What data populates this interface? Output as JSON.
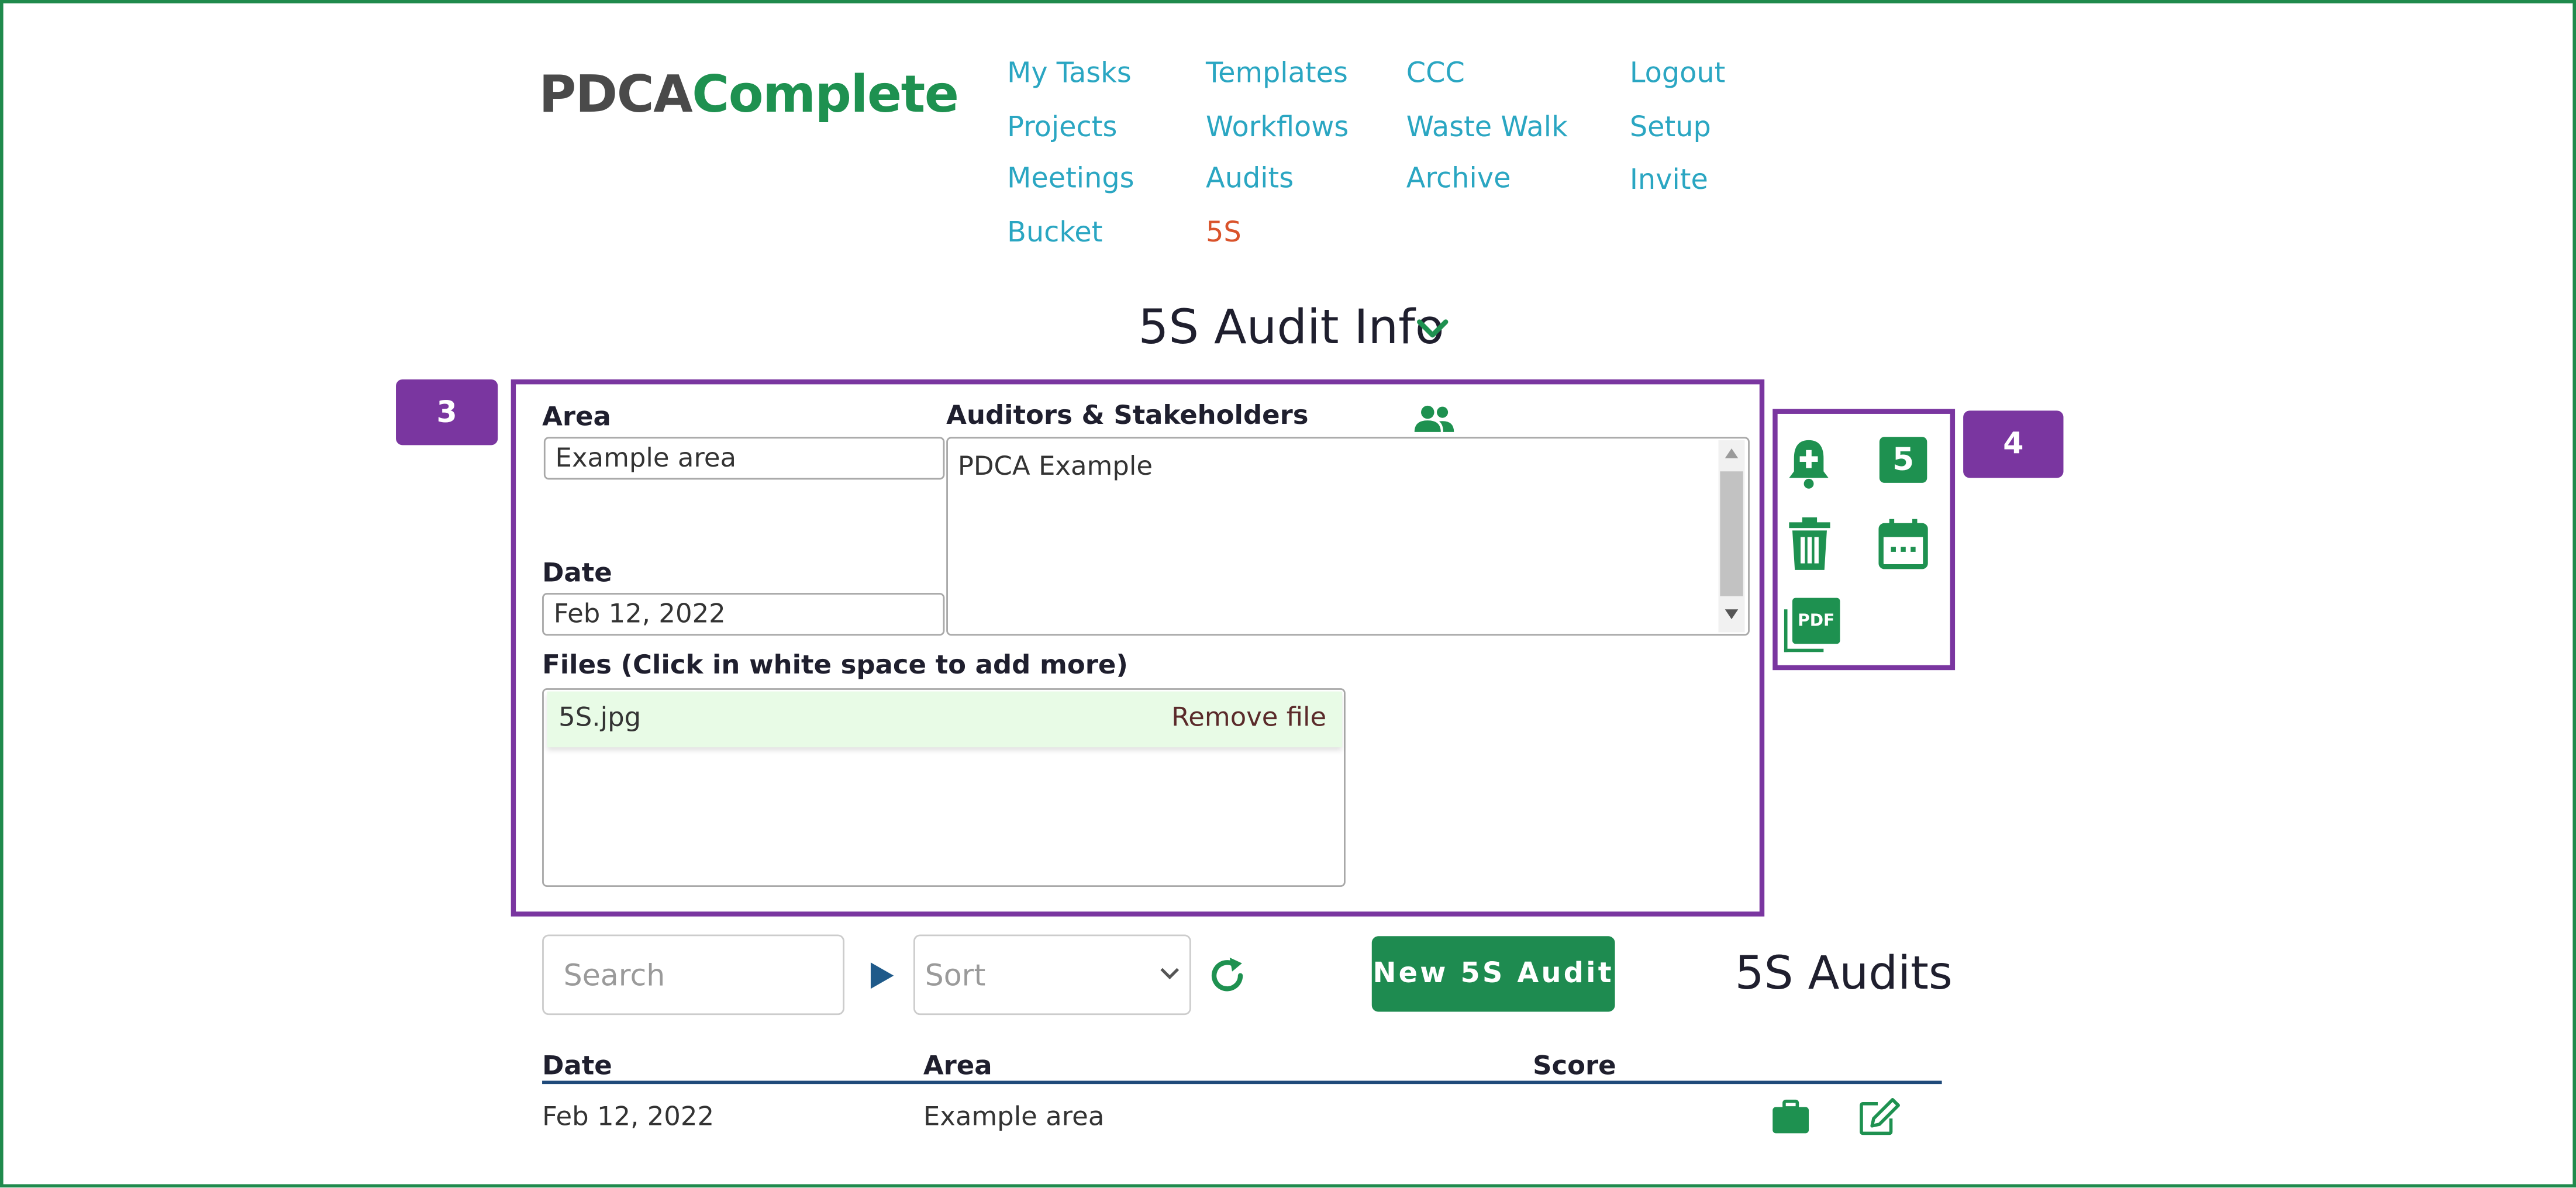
{
  "logo": {
    "part1": "PDCA",
    "part2": "Complete"
  },
  "nav": {
    "col1": [
      "My Tasks",
      "Projects",
      "Meetings",
      "Bucket"
    ],
    "col2": [
      "Templates",
      "Workflows",
      "Audits",
      "5S"
    ],
    "col3": [
      "CCC",
      "Waste Walk",
      "Archive"
    ],
    "col4": [
      "Logout",
      "Setup",
      "Invite"
    ],
    "active": "5S"
  },
  "page_title": "5S Audit Info",
  "annotations": {
    "badge_left": "3",
    "badge_right": "4"
  },
  "form": {
    "area_label": "Area",
    "area_value": "Example area",
    "date_label": "Date",
    "date_value": "Feb 12, 2022",
    "auditors_label": "Auditors & Stakeholders",
    "auditors_value": "PDCA Example",
    "files_label": "Files (Click in white space to add more)",
    "files": [
      {
        "name": "5S.jpg",
        "action": "Remove file"
      }
    ]
  },
  "side_icons": [
    "bell-plus-icon",
    "five-s-icon",
    "trash-icon",
    "calendar-icon",
    "pdf-icon"
  ],
  "five_s_glyph": "5",
  "pdf_glyph": "PDF",
  "toolbar": {
    "search_placeholder": "Search",
    "sort_placeholder": "Sort",
    "new_button": "New 5S Audit",
    "list_title": "5S Audits"
  },
  "table": {
    "headers": {
      "date": "Date",
      "area": "Area",
      "score": "Score"
    },
    "rows": [
      {
        "date": "Feb 12, 2022",
        "area": "Example area",
        "score": ""
      }
    ]
  },
  "colors": {
    "brand_green": "#1e9150",
    "link": "#2aa6c2",
    "active": "#d9532b",
    "annotation": "#7a36a0"
  }
}
